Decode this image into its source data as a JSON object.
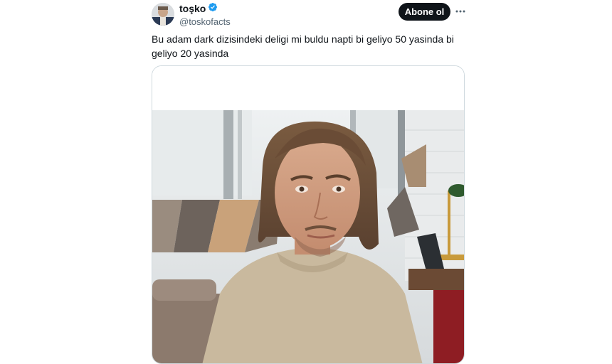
{
  "tweet": {
    "author": {
      "display_name": "toşko",
      "handle": "@toskofacts",
      "verified_icon": "verified-badge-icon",
      "verified_color": "#1d9bf0"
    },
    "follow_label": "Abone ol",
    "more_icon": "more-horizontal-icon",
    "text": "Bu adam dark dizisindeki deligi mi buldu napti bi geliyo 50 yasinda bi geliyo 20 yasinda"
  },
  "colors": {
    "text": "#0f1419",
    "secondary": "#536471",
    "button_bg": "#0f1419",
    "button_text": "#ffffff",
    "border": "#cfd9de"
  }
}
